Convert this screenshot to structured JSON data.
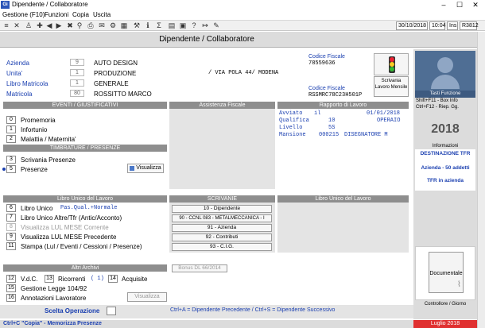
{
  "window": {
    "title": "Dipendente / Collaboratore",
    "app_icon": "Gi"
  },
  "menu": [
    "Gestione (F10)",
    "Funzioni",
    "Copia",
    "Uscita"
  ],
  "toolbar": {
    "date": "30/10/2018",
    "time": "10:04",
    "ins": "Ins",
    "code": "R3812"
  },
  "header": {
    "title": "Dipendente / Collaboratore"
  },
  "fields": {
    "azienda": {
      "label": "Azienda",
      "code": "9",
      "value": "AUTO DESIGN"
    },
    "unita": {
      "label": "Unita'",
      "code": "1",
      "value": "PRODUZIONE",
      "address": "/ VIA POLA 44/ MODENA"
    },
    "libro": {
      "label": "Libro Matricola",
      "code": "1",
      "value": "GENERALE"
    },
    "matricola": {
      "label": "Matricola",
      "code": "80",
      "value": "ROSSITTO MARCO"
    }
  },
  "codice_fiscale": {
    "label1": "Codice Fiscale",
    "value1": "78559636",
    "label2": "Codice Fiscale",
    "value2": "RSSMRC78C23H501P"
  },
  "scrivania": {
    "label": "Scrivania Lavoro Mensile"
  },
  "sections": {
    "eventi": "EVENTI / GIUSTIFICATIVI",
    "timbrature": "TIMBRATURE / PRESENZE",
    "assistenza": "Assistenza Fiscale",
    "rapporto": "Rapporto di Lavoro",
    "libro_unico": "Libro Unico del Lavoro",
    "scrivanie": "SCRIVANIE",
    "libro_unico2": "Libro Unico del Lavoro",
    "altri": "Altri Archivi"
  },
  "eventi_items": [
    {
      "num": "0",
      "label": "Promemoria"
    },
    {
      "num": "1",
      "label": "Infortunio"
    },
    {
      "num": "2",
      "label": "Malattia / Maternita'"
    }
  ],
  "timbrature_items": [
    {
      "num": "3",
      "label": "Scrivania Presenze"
    },
    {
      "num": "5",
      "label": "Presenze"
    }
  ],
  "visualizza": "Visualizza",
  "rapporto": {
    "rows": [
      {
        "k": "Avviato",
        "v": "il",
        "r": "01/01/2018"
      },
      {
        "k": "Qualifica",
        "v": "10",
        "r": "OPERAIO"
      },
      {
        "k": "Livello",
        "v": "5S",
        "r": ""
      },
      {
        "k": "Mansione",
        "v": "000215",
        "r": "DISEGNATORE M"
      }
    ]
  },
  "libro_items": [
    {
      "num": "6",
      "label": "Libro Unico",
      "extra": "Pas.Qual.+Normale",
      "disabled": false
    },
    {
      "num": "7",
      "label": "Libro Unico Altre/Tfr (Antic/Acconto)",
      "extra": "",
      "disabled": false
    },
    {
      "num": "8",
      "label": "Visualizza LUL  MESE Corrente",
      "extra": "",
      "disabled": true
    },
    {
      "num": "9",
      "label": "Visualizza LUL  MESE Precedente",
      "extra": "",
      "disabled": false
    },
    {
      "num": "11",
      "label": "Stampa (Lul / Eventi / Cessioni / Presenze)",
      "extra": "",
      "disabled": false
    }
  ],
  "scrivanie_buttons": [
    "10 - Dipendente",
    "90 - CCNL 083 - METALMECCANICA - I",
    "91 - Azienda",
    "92 - Contributi",
    "93 - C.I.G."
  ],
  "bonus": "Bonus DL 66/2014",
  "altri": {
    "vdc_num": "12",
    "vdc": "V.d.C.",
    "ric_num": "13",
    "ric": "Ricorrenti",
    "ric_count": "( 1)",
    "acq_num": "14",
    "acq": "Acquisite",
    "gest_num": "15",
    "gest": "Gestione Legge 104/92",
    "ann_num": "16",
    "ann": "Annotazioni Lavoratore"
  },
  "scelta": {
    "label": "Scelta Operazione",
    "visualizza": "Visualizza"
  },
  "shortcuts_hint": "Ctrl+A = Dipendente Precedente  /  Ctrl+S = Dipendente Successivo",
  "right": {
    "tasti_label": "Tasti Funzione",
    "keys": [
      {
        "k": "Shift+F11",
        "v": "- Box Info"
      },
      {
        "k": "Ctrl+F12",
        "v": "- Riep. Gg."
      }
    ],
    "year": "2018",
    "informazioni": "Informazioni",
    "dest": "DESTINAZIONE  TFR",
    "azienda50": "Azienda - 50 addetti",
    "tfr": "TFR in azienda",
    "documentale": "Documentale",
    "controllore": "Controllore / Giorno"
  },
  "status": {
    "left": "Ctrl+C \"Copia\"  -  Memorizza Presenze",
    "right": "Luglio  2018"
  }
}
